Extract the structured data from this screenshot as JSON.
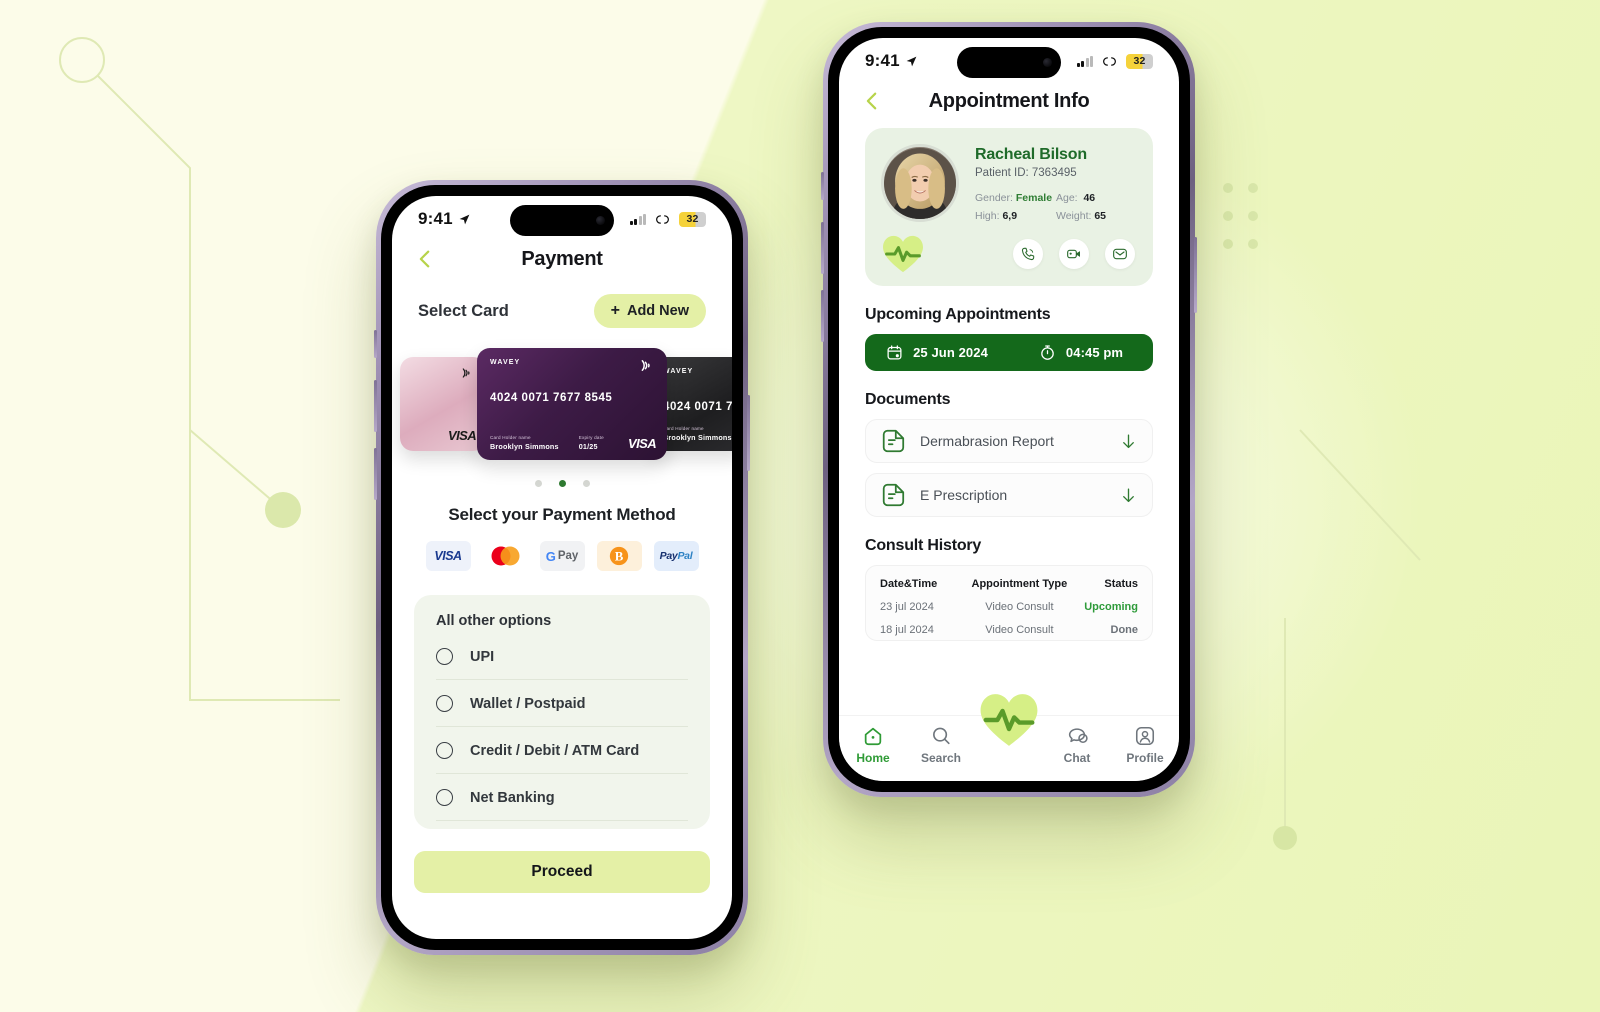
{
  "theme": {
    "accent_lime": "#e4f0a6",
    "accent_green": "#2f9b36",
    "dark_green": "#14691b",
    "page_bg": "#fcfce9",
    "panel_green": "#e9f2e4"
  },
  "status_bar": {
    "time": "9:41",
    "battery": "32",
    "location_icon": "location-arrow-icon",
    "signal_icon": "signal-bars-icon",
    "wifi_icon": "link-icon"
  },
  "payment_screen": {
    "title": "Payment",
    "back_icon": "chevron-left-icon",
    "select_card_label": "Select Card",
    "add_new_label": "Add New",
    "add_new_plus": "+",
    "cards": [
      {
        "brand": "",
        "number": "",
        "holder_label": "",
        "holder": "",
        "expiry_label": "",
        "expiry": "",
        "network": "VISA",
        "style": "pink"
      },
      {
        "brand": "WAVEY",
        "number": "4024 0071 7677 8545",
        "holder_label": "Card Holder name",
        "holder": "Brooklyn Simmons",
        "expiry_label": "Expiry date",
        "expiry": "01/25",
        "network": "VISA",
        "style": "purple"
      },
      {
        "brand": "WAVEY",
        "number": "4024 0071 7",
        "holder_label": "Card Holder name",
        "holder": "Brooklyn Simmons",
        "expiry_label": "",
        "expiry": "",
        "network": "",
        "style": "black"
      }
    ],
    "carousel_dots": 3,
    "carousel_active_index": 1,
    "payment_method_title": "Select your Payment Method",
    "payment_methods": [
      {
        "name": "visa",
        "label": "VISA"
      },
      {
        "name": "mastercard",
        "label": ""
      },
      {
        "name": "gpay",
        "label": "G Pay",
        "g": "G",
        "pay": "Pay"
      },
      {
        "name": "bitcoin",
        "label": ""
      },
      {
        "name": "paypal",
        "label": "PayPal",
        "p1": "Pay",
        "p2": "Pal"
      }
    ],
    "other_options_title": "All other options",
    "other_options": [
      {
        "label": "UPI",
        "selected": false
      },
      {
        "label": "Wallet / Postpaid",
        "selected": false
      },
      {
        "label": "Credit / Debit / ATM Card",
        "selected": false
      },
      {
        "label": "Net Banking",
        "selected": false
      }
    ],
    "proceed_label": "Proceed"
  },
  "appointment_screen": {
    "title": "Appointment Info",
    "back_icon": "chevron-left-icon",
    "patient": {
      "name": "Racheal Bilson",
      "patient_id_text": "Patient ID: 7363495",
      "gender_label": "Gender:",
      "gender_value": "Female",
      "age_label": "Age:",
      "age_value": "46",
      "high_label": "High:",
      "high_value": "6,9",
      "weight_label": "Weight:",
      "weight_value": "65",
      "actions": [
        {
          "name": "call-icon"
        },
        {
          "name": "video-call-icon"
        },
        {
          "name": "message-icon"
        }
      ]
    },
    "upcoming_title": "Upcoming Appointments",
    "upcoming": {
      "date": "25 Jun 2024",
      "time": "04:45 pm",
      "calendar_icon": "calendar-icon",
      "clock_icon": "stopwatch-icon"
    },
    "documents_title": "Documents",
    "documents": [
      {
        "name": "Dermabrasion Report",
        "icon": "document-icon",
        "action": "download-icon"
      },
      {
        "name": "E Prescription",
        "icon": "document-icon",
        "action": "download-icon"
      }
    ],
    "consult_history_title": "Consult History",
    "consult_history": {
      "columns": [
        "Date&Time",
        "Appointment Type",
        "Status"
      ],
      "rows": [
        {
          "date": "23 jul 2024",
          "type": "Video Consult",
          "status": "Upcoming",
          "status_state": "upcoming"
        },
        {
          "date": "18 jul 2024",
          "type": "Video Consult",
          "status": "Done",
          "status_state": "done"
        }
      ]
    },
    "tabs": [
      {
        "label": "Home",
        "icon": "home-icon",
        "active": true
      },
      {
        "label": "Search",
        "icon": "search-icon",
        "active": false
      },
      {
        "label": "",
        "icon": "heart-pulse-logo",
        "active": false
      },
      {
        "label": "Chat",
        "icon": "chat-icon",
        "active": false
      },
      {
        "label": "Profile",
        "icon": "profile-icon",
        "active": false
      }
    ]
  }
}
